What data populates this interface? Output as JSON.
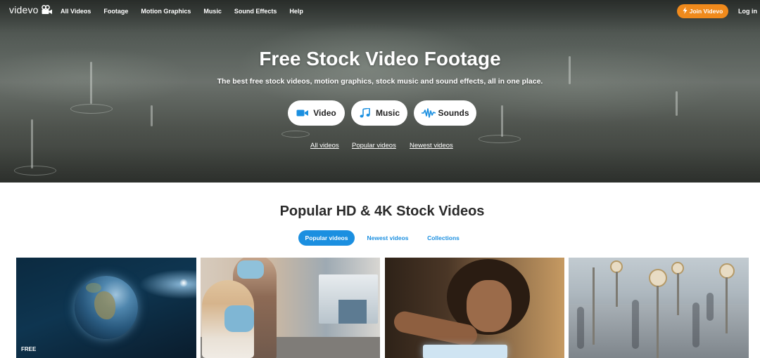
{
  "brand": {
    "name": "videvo",
    "icon": "camera-icon"
  },
  "nav": {
    "links": [
      "All Videos",
      "Footage",
      "Motion Graphics",
      "Music",
      "Sound Effects",
      "Help"
    ],
    "join_label": "Join Videvo",
    "join_icon": "bolt-icon",
    "login_label": "Log in"
  },
  "hero": {
    "title": "Free Stock Video Footage",
    "subtitle": "The best free stock videos, motion graphics, stock music and sound effects, all in one place.",
    "buttons": [
      {
        "label": "Video",
        "icon": "video-camera-icon"
      },
      {
        "label": "Music",
        "icon": "music-note-icon"
      },
      {
        "label": "Sounds",
        "icon": "waveform-icon"
      }
    ],
    "links": [
      "All videos",
      "Popular videos",
      "Newest videos"
    ]
  },
  "main": {
    "title": "Popular HD & 4K Stock Videos",
    "tabs": [
      "Popular videos",
      "Newest videos",
      "Collections"
    ],
    "active_tab": "Popular videos",
    "thumbnails": [
      {
        "badge": "FREE"
      },
      {
        "badge": ""
      },
      {
        "badge": ""
      },
      {
        "badge": ""
      }
    ]
  },
  "colors": {
    "accent_blue": "#1b8fe0",
    "join_orange": "#f08a1c",
    "icon_blue": "#1b8fe0"
  }
}
